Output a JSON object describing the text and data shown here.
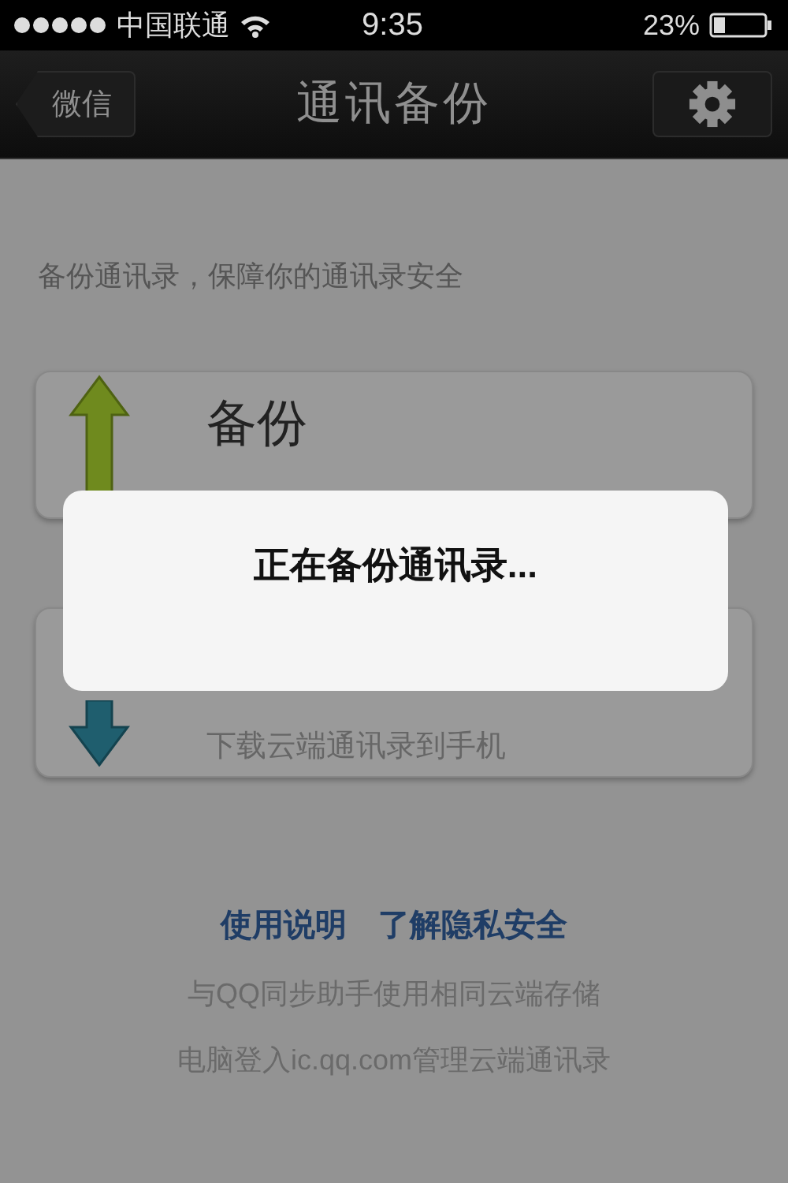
{
  "status_bar": {
    "carrier": "中国联通",
    "time": "9:35",
    "battery": "23%"
  },
  "nav_bar": {
    "back": "微信",
    "title": "通讯备份"
  },
  "intro": "备份通讯录，保障你的通讯录安全",
  "cards": [
    {
      "kind": "upload",
      "title": "备份"
    },
    {
      "kind": "download",
      "subtitle": "下载云端通讯录到手机"
    }
  ],
  "links": [
    "使用说明",
    "了解隐私安全"
  ],
  "notes": [
    "与QQ同步助手使用相同云端存储",
    "电脑登入ic.qq.com管理云端通讯录"
  ],
  "dialog": {
    "message": "正在备份通讯录..."
  }
}
